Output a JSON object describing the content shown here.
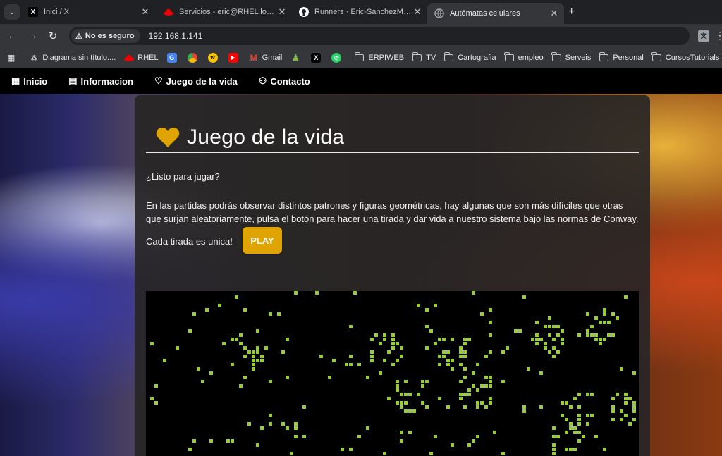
{
  "browser": {
    "tabs": [
      {
        "title": "Inici / X",
        "favicon": "x-logo-icon",
        "active": false
      },
      {
        "title": "Servicios - eric@RHEL local lab",
        "favicon": "redhat-icon",
        "active": false
      },
      {
        "title": "Runners · Eric-SanchezMarch/p",
        "favicon": "github-icon",
        "active": false
      },
      {
        "title": "Autómatas celulares",
        "favicon": "globe-icon",
        "active": true
      }
    ],
    "security_label": "No es seguro",
    "url": "192.168.1.141",
    "bookmarks": [
      {
        "label": "Diagrama sin título....",
        "kind": "diagram"
      },
      {
        "label": "RHEL",
        "kind": "redhat"
      },
      {
        "label": "",
        "kind": "translate"
      },
      {
        "label": "",
        "kind": "chrome"
      },
      {
        "label": "",
        "kind": "tv"
      },
      {
        "label": "",
        "kind": "youtube"
      },
      {
        "label": "Gmail",
        "kind": "gmail"
      },
      {
        "label": "",
        "kind": "chess"
      },
      {
        "label": "",
        "kind": "x"
      },
      {
        "label": "",
        "kind": "whatsapp"
      },
      {
        "label": "ERPIWEB",
        "kind": "folder"
      },
      {
        "label": "TV",
        "kind": "folder"
      },
      {
        "label": "Cartografia",
        "kind": "folder"
      },
      {
        "label": "empleo",
        "kind": "folder"
      },
      {
        "label": "Serveis",
        "kind": "folder"
      },
      {
        "label": "Personal",
        "kind": "folder"
      },
      {
        "label": "CursosTutorials",
        "kind": "folder"
      }
    ]
  },
  "site": {
    "nav": [
      {
        "label": "Inicio",
        "icon": "grid-icon"
      },
      {
        "label": "Informacion",
        "icon": "book-icon"
      },
      {
        "label": "Juego de la vida",
        "icon": "heart-icon"
      },
      {
        "label": "Contacto",
        "icon": "user-icon"
      }
    ],
    "title": "Juego de la vida",
    "intro": "¿Listo para jugar?",
    "description": "En las partidas podrás observar distintos patrones y figuras geométricas, hay algunas que son más difíciles que otras que surjan aleatoriamente, pulsa el botón para hacer una tirada y dar vida a nuestro sistema bajo las normas de Conway.",
    "unique_note": "Cada tirada es unica!",
    "play_label": "PLAY"
  },
  "colors": {
    "accent": "#e0a400",
    "cell": "#9acd32",
    "board": "#000000"
  }
}
